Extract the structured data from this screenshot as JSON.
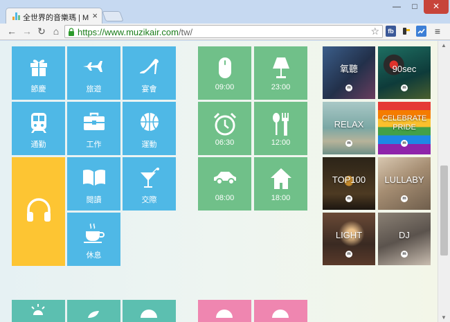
{
  "browser": {
    "tab_title": "全世界的音樂瑪 | MUZIK",
    "tab_close": "×",
    "url_main": "https://www.muzikair.com",
    "url_rest": "/tw/",
    "window": {
      "minimize": "—",
      "maximize": "□",
      "close": "✕"
    },
    "nav": {
      "back": "←",
      "forward": "→",
      "reload": "↻",
      "home": "⌂"
    },
    "star": "☆",
    "ext_fb": "fb",
    "menu": "≡"
  },
  "mood_tiles": [
    {
      "label": "節慶",
      "icon": "gift-icon"
    },
    {
      "label": "旅遊",
      "icon": "airplane-icon"
    },
    {
      "label": "宴會",
      "icon": "high-heel-icon"
    },
    {
      "label": "通勤",
      "icon": "train-icon"
    },
    {
      "label": "工作",
      "icon": "toolbox-icon"
    },
    {
      "label": "運動",
      "icon": "basketball-icon"
    },
    {
      "label": "閱讀",
      "icon": "book-icon"
    },
    {
      "label": "交際",
      "icon": "cocktail-icon"
    },
    {
      "label": "休息",
      "icon": "coffee-icon"
    }
  ],
  "featured_tile": {
    "icon": "headphones-icon"
  },
  "time_tiles": [
    {
      "label": "09:00",
      "icon": "mouse-icon"
    },
    {
      "label": "23:00",
      "icon": "lamp-icon"
    },
    {
      "label": "06:30",
      "icon": "alarm-clock-icon"
    },
    {
      "label": "12:00",
      "icon": "utensils-icon"
    },
    {
      "label": "08:00",
      "icon": "car-icon"
    },
    {
      "label": "18:00",
      "icon": "house-icon"
    }
  ],
  "playlists": [
    {
      "title": "氧聽"
    },
    {
      "title": "90sec"
    },
    {
      "title": "RELAX"
    },
    {
      "title": "CELEBRATE PRIDE"
    },
    {
      "title": "TOP100"
    },
    {
      "title": "LULLABY"
    },
    {
      "title": "LIGHT"
    },
    {
      "title": "DJ"
    }
  ],
  "badge_letter": "m",
  "colors": {
    "blue": "#4fb8e6",
    "green": "#70c089",
    "yellow": "#fdc533",
    "teal": "#5cbfb0",
    "pink": "#ef86b0"
  }
}
